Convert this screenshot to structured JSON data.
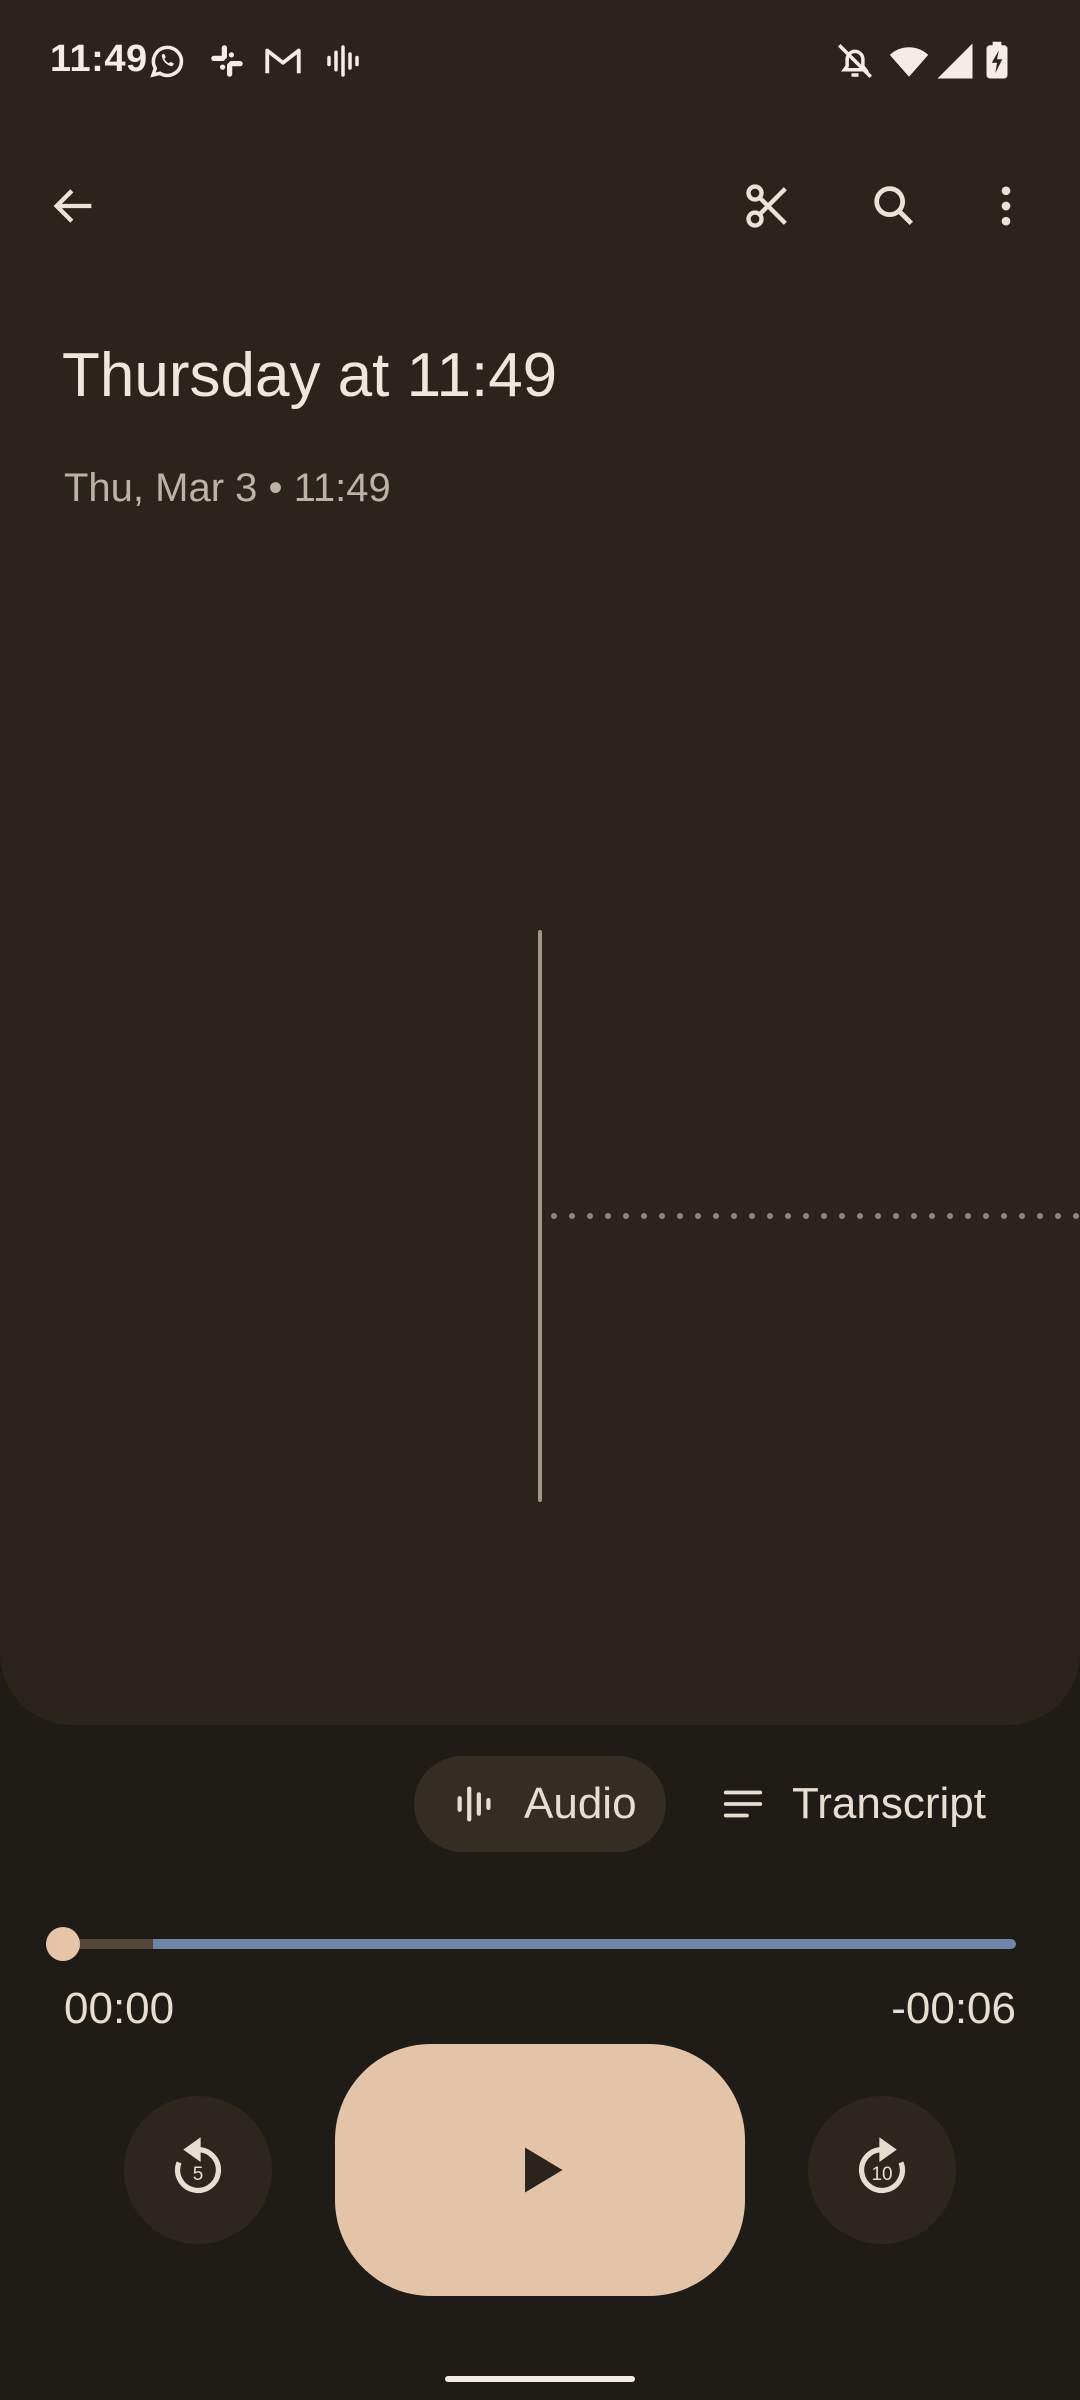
{
  "status_bar": {
    "time": "11:49",
    "left_icons": [
      "whatsapp-icon",
      "slack-icon",
      "gmail-icon",
      "recorder-icon"
    ],
    "right_icons": [
      "bell-off-icon",
      "wifi-icon",
      "signal-icon",
      "battery-charging-icon"
    ]
  },
  "app_bar": {
    "icons": [
      "back-arrow-icon",
      "scissors-icon",
      "search-icon",
      "more-vert-icon"
    ]
  },
  "recording": {
    "title": "Thursday at 11:49",
    "meta": "Thu, Mar 3 • 11:49"
  },
  "tabs": [
    {
      "label": "Audio",
      "icon": "waveform-icon",
      "selected": true
    },
    {
      "label": "Transcript",
      "icon": "lines-icon",
      "selected": false
    }
  ],
  "player": {
    "elapsed": "00:00",
    "remaining": "-00:06",
    "progress": 0.0,
    "buffered": 0.11,
    "rewind_seconds": "5",
    "forward_seconds": "10"
  },
  "colors": {
    "background": "#1f1c18",
    "card": "#2a241d",
    "accent": "#e3c4a8",
    "track": "#6f84a6"
  }
}
